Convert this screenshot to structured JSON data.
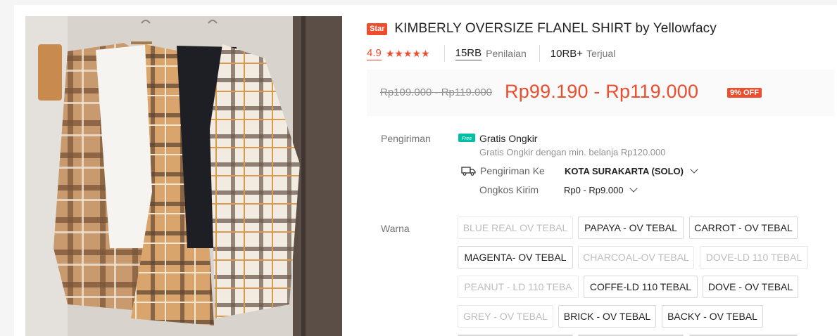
{
  "product": {
    "badge": "Star",
    "title": "KIMBERLY OVERSIZE FLANEL SHIRT by Yellowfacy"
  },
  "rating": {
    "value": "4.9",
    "stars": "★★★★★",
    "reviews_count": "15RB",
    "reviews_label": "Penilaian",
    "sold_count": "10RB+",
    "sold_label": "Terjual"
  },
  "price": {
    "original": "Rp109.000 - Rp119.000",
    "current": "Rp99.190 - Rp119.000",
    "discount": "9% OFF"
  },
  "shipping": {
    "label": "Pengiriman",
    "free_icon": "free-shipping-icon",
    "free_icon_text": "Free",
    "free_title": "Gratis Ongkir",
    "free_subtitle": "Gratis Ongkir dengan min. belanja Rp120.000",
    "to_label": "Pengiriman Ke",
    "to_value": "KOTA SURAKARTA (SOLO)",
    "cost_label": "Ongkos Kirim",
    "cost_value": "Rp0 - Rp9.000"
  },
  "variants": {
    "label": "Warna",
    "options": [
      {
        "label": "BLUE REAL OV TEBAL",
        "available": false
      },
      {
        "label": "PAPAYA - OV TEBAL",
        "available": true
      },
      {
        "label": "CARROT - OV TEBAL",
        "available": true
      },
      {
        "label": "MAGENTA- OV TEBAL",
        "available": true
      },
      {
        "label": "CHARCOAL-OV TEBAL",
        "available": false
      },
      {
        "label": "DOVE-LD 110 TEBAL",
        "available": false
      },
      {
        "label": "PEANUT - LD 110 TEBA",
        "available": false
      },
      {
        "label": "COFFE-LD 110 TEBAL",
        "available": true
      },
      {
        "label": "DOVE - OV TEBAL",
        "available": true
      },
      {
        "label": "GREY - OV TEBAL",
        "available": false
      },
      {
        "label": "BRICK - OV TEBAL",
        "available": true
      },
      {
        "label": "BACKY - OV TEBAL",
        "available": true
      }
    ]
  },
  "colors": {
    "accent": "#ee4d2d",
    "free_shipping": "#00bfa5"
  }
}
